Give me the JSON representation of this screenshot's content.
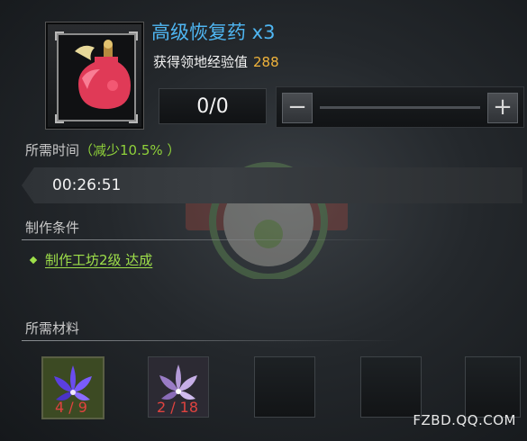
{
  "item": {
    "name": "高级恢复药 x3",
    "exp_label": "获得领地经验值",
    "exp_value": "288",
    "icon": "potion-icon"
  },
  "quantity": {
    "value": "0/0",
    "minus_label": "−",
    "plus_label": "+"
  },
  "time": {
    "label": "所需时间",
    "reduction": "（减少10.5%  ）",
    "value": "00:26:51"
  },
  "conditions": {
    "label": "制作条件",
    "items": [
      "制作工坊2级 达成"
    ]
  },
  "materials": {
    "label": "所需材料",
    "slots": [
      {
        "icon": "blue-lily-icon",
        "count": "4 / 9"
      },
      {
        "icon": "purple-lily-icon",
        "count": "2 / 18"
      },
      {
        "icon": "",
        "count": ""
      },
      {
        "icon": "",
        "count": ""
      },
      {
        "icon": "",
        "count": ""
      }
    ]
  },
  "site_tag": "FZBD.QQ.COM",
  "colors": {
    "title_blue": "#4fb6f2",
    "exp_gold": "#f0b33b",
    "green": "#9ee04a",
    "count_red": "#e0433f"
  }
}
